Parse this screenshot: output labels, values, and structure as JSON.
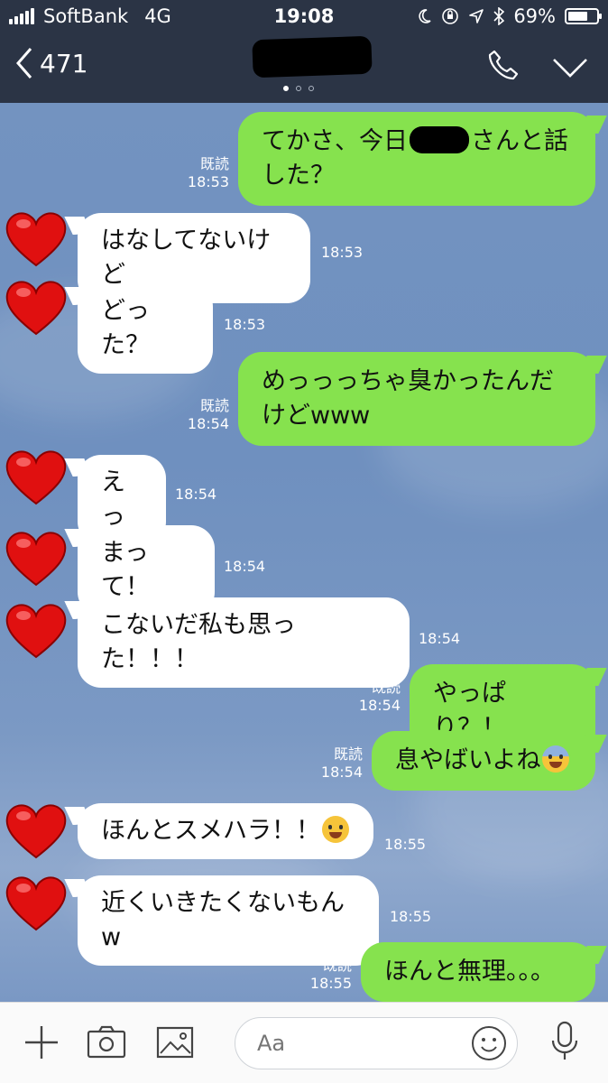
{
  "status": {
    "carrier": "SoftBank",
    "network": "4G",
    "time": "19:08",
    "battery": "69%",
    "battery_fraction": 0.69
  },
  "header": {
    "back_count": "471"
  },
  "chat": {
    "read_label": "既読",
    "messages": [
      {
        "dir": "out",
        "text_before": "てかさ、今日",
        "text_after": "さんと話した？",
        "time": "18:53"
      },
      {
        "dir": "in",
        "text": "はなしてないけど",
        "time": "18:53"
      },
      {
        "dir": "in",
        "text": "どった？",
        "time": "18:53"
      },
      {
        "dir": "out",
        "text": "めっっっちゃ臭かったんだけどwww",
        "time": "18:54"
      },
      {
        "dir": "in",
        "text": "えっ",
        "time": "18:54"
      },
      {
        "dir": "in",
        "text": "まって！",
        "time": "18:54"
      },
      {
        "dir": "in",
        "text": "こないだ私も思った！！！",
        "time": "18:54"
      },
      {
        "dir": "out",
        "text": "やっぱり？！",
        "time": "18:54"
      },
      {
        "dir": "out",
        "text": "息やばいよね",
        "emoji": "fearful-face",
        "time": "18:54"
      },
      {
        "dir": "in",
        "text": "ほんとスメハラ！！",
        "emoji": "tears-of-joy-face",
        "time": "18:55"
      },
      {
        "dir": "in",
        "text": "近くいきたくないもんw",
        "time": "18:55"
      },
      {
        "dir": "out",
        "text": "ほんと無理。。。",
        "time": "18:55"
      }
    ]
  },
  "input": {
    "placeholder": "Aa"
  },
  "colors": {
    "header_bg": "#2b3445",
    "sent_bubble": "#86e24e",
    "received_bubble": "#ffffff",
    "chat_bg": "#7393c0"
  },
  "icons": [
    "chevron-left-icon",
    "phone-icon",
    "chevron-down-icon",
    "plus-icon",
    "camera-icon",
    "image-icon",
    "smiley-icon",
    "microphone-icon",
    "heart-avatar-icon"
  ]
}
